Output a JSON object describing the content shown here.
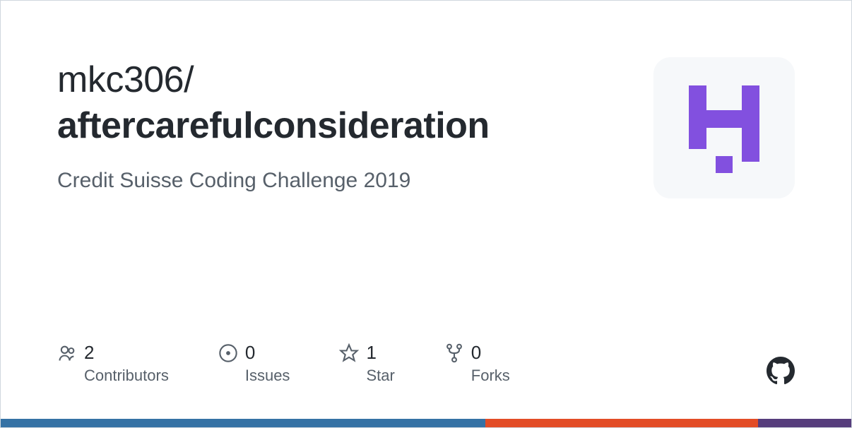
{
  "repo": {
    "owner": "mkc306",
    "separator": "/",
    "name": "aftercarefulconsideration",
    "description": "Credit Suisse Coding Challenge 2019"
  },
  "stats": {
    "contributors": {
      "count": "2",
      "label": "Contributors"
    },
    "issues": {
      "count": "0",
      "label": "Issues"
    },
    "star": {
      "count": "1",
      "label": "Star"
    },
    "forks": {
      "count": "0",
      "label": "Forks"
    }
  },
  "colors": {
    "avatar_accent": "#8250df",
    "bar_segments": [
      {
        "color": "#3572A5",
        "width": "57%"
      },
      {
        "color": "#e34c26",
        "width": "32%"
      },
      {
        "color": "#563d7c",
        "width": "11%"
      }
    ]
  }
}
